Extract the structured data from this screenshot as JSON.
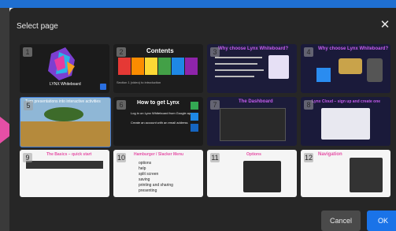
{
  "dialog": {
    "title": "Select page",
    "cancel_label": "Cancel",
    "ok_label": "OK"
  },
  "pages": [
    {
      "number": "1",
      "title": "LYNX Whiteboard",
      "badge": "Lynx"
    },
    {
      "number": "2",
      "title": "Contents",
      "caption": "Section 1 (video) to introduction"
    },
    {
      "number": "3",
      "title": "Why choose Lynx Whiteboard?"
    },
    {
      "number": "4",
      "title": "Why choose Lynx Whiteboard?"
    },
    {
      "number": "5",
      "title": "Turn presentations into interactive activities"
    },
    {
      "number": "6",
      "title": "How to get Lynx",
      "bullets": [
        "Log in on Lynx Whiteboard from Google app",
        "Create an account with an email address"
      ]
    },
    {
      "number": "7",
      "title": "The Dashboard"
    },
    {
      "number": "8",
      "title": "Lynx Cloud – sign up and create one"
    },
    {
      "number": "9",
      "title": "The Basics – quick start"
    },
    {
      "number": "10",
      "title": "Hamburger / Slacker Menu",
      "items": [
        "options",
        "help",
        "split screen",
        "saving",
        "printing and sharing",
        "presenting"
      ]
    },
    {
      "number": "11",
      "title": "Options"
    },
    {
      "number": "12",
      "title": "Navigation"
    }
  ],
  "colors": {
    "accent": "#1a73e8",
    "top_bar": "#1f6fd1",
    "selection_arrow": "#e64fa6",
    "dialog_bg": "#262626"
  }
}
